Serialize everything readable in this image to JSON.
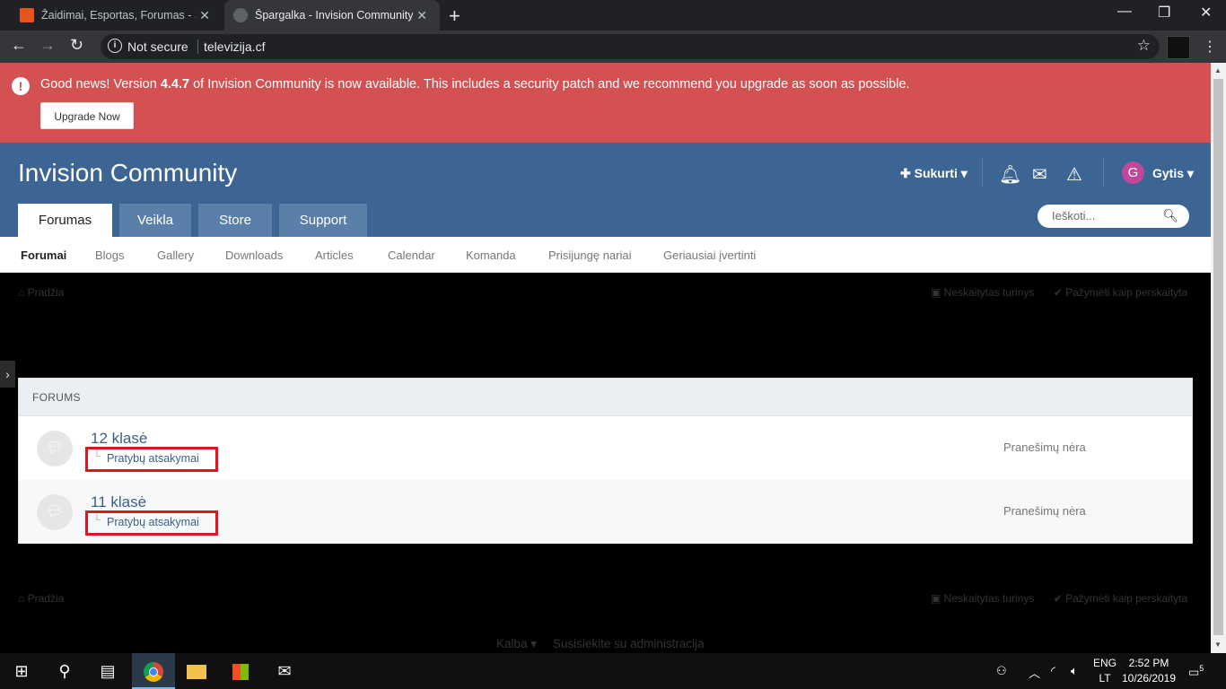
{
  "browser": {
    "tabs": [
      {
        "title": "Žaidimai, Esportas, Forumas - Sup",
        "active": false
      },
      {
        "title": "Špargalka - Invision Community",
        "active": true
      }
    ],
    "omnibox": {
      "security_label": "Not secure",
      "url": "televizija.cf"
    }
  },
  "alert": {
    "msg_before": "Good news! Version ",
    "version": "4.4.7",
    "msg_after": " of Invision Community is now available. This includes a security patch and we recommend you upgrade as soon as possible.",
    "button_label": "Upgrade Now",
    "color": "#d35151"
  },
  "header": {
    "site_title": "Invision Community",
    "create_label": "Sukurti",
    "user_initial": "G",
    "user_name": "Gytis",
    "color": "#3d6594",
    "main_tabs": [
      "Forumas",
      "Veikla",
      "Store",
      "Support"
    ],
    "search_placeholder": "Ieškoti..."
  },
  "subnav": {
    "items": [
      "Forumai",
      "Blogs",
      "Gallery",
      "Downloads",
      "Articles",
      "Calendar",
      "Komanda",
      "Prisijungę nariai",
      "Geriausiai įvertinti"
    ]
  },
  "breadcrumb": {
    "home": "Pradžia",
    "unread": "Neskaitytas turinys",
    "mark_read": "Pažymėti kaip perskaityta"
  },
  "forums": {
    "heading": "FORUMS",
    "rows": [
      {
        "title": "12 klasė",
        "subforum": "Pratybų atsakymai",
        "last_post": "Pranešimų nėra"
      },
      {
        "title": "11 klasė",
        "subforum": "Pratybų atsakymai",
        "last_post": "Pranešimų nėra"
      }
    ]
  },
  "footer": {
    "language": "Kalba",
    "contact": "Susisiekite su administracija"
  },
  "taskbar": {
    "language_top": "ENG",
    "language_bottom": "LT",
    "time": "2:52 PM",
    "date": "10/26/2019",
    "notifications": "5"
  }
}
